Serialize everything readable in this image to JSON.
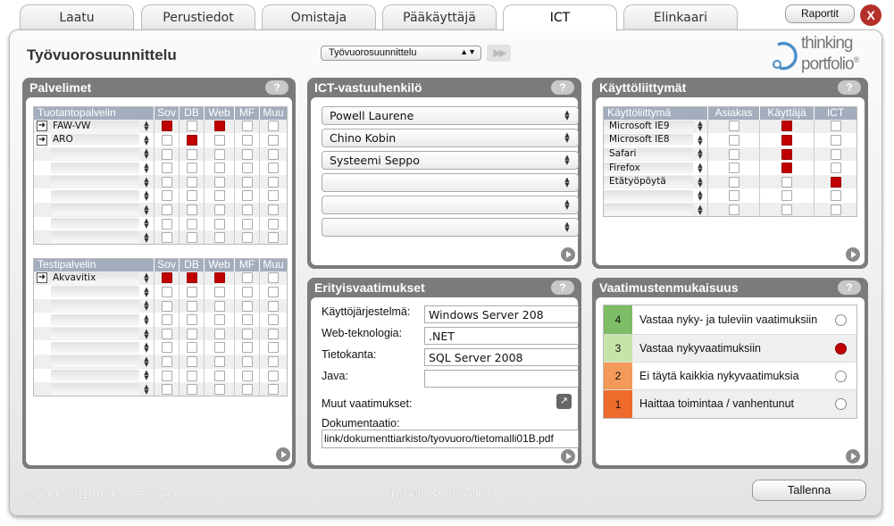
{
  "tabs": [
    {
      "label": "Laatu"
    },
    {
      "label": "Perustiedot"
    },
    {
      "label": "Omistaja"
    },
    {
      "label": "Pääkäyttäjä"
    },
    {
      "label": "ICT",
      "active": true
    },
    {
      "label": "Elinkaari"
    }
  ],
  "reports_label": "Raportit",
  "close_label": "X",
  "page_title": "Työvuorosuunnittelu",
  "system_select": {
    "value": "Työvuorosuunnittelu"
  },
  "logo": {
    "line1": "thinking",
    "line2": "portfolio",
    "mark": "®"
  },
  "servers": {
    "title": "Palvelimet",
    "help": "?",
    "columns": [
      "Sov",
      "DB",
      "Web",
      "MF",
      "Muu"
    ],
    "production": {
      "header": "Tuotantopalvelin",
      "rows": [
        {
          "name": "FAW-VW",
          "checks": [
            true,
            false,
            true,
            false,
            false
          ]
        },
        {
          "name": "ARO",
          "checks": [
            false,
            true,
            false,
            false,
            false
          ]
        },
        {
          "name": "",
          "checks": [
            false,
            false,
            false,
            false,
            false
          ]
        },
        {
          "name": "",
          "checks": [
            false,
            false,
            false,
            false,
            false
          ]
        },
        {
          "name": "",
          "checks": [
            false,
            false,
            false,
            false,
            false
          ]
        },
        {
          "name": "",
          "checks": [
            false,
            false,
            false,
            false,
            false
          ]
        },
        {
          "name": "",
          "checks": [
            false,
            false,
            false,
            false,
            false
          ]
        },
        {
          "name": "",
          "checks": [
            false,
            false,
            false,
            false,
            false
          ]
        },
        {
          "name": "",
          "checks": [
            false,
            false,
            false,
            false,
            false
          ]
        }
      ]
    },
    "test": {
      "header": "Testipalvelin",
      "rows": [
        {
          "name": "Akvavitix",
          "checks": [
            true,
            true,
            true,
            false,
            false
          ]
        },
        {
          "name": "",
          "checks": [
            false,
            false,
            false,
            false,
            false
          ]
        },
        {
          "name": "",
          "checks": [
            false,
            false,
            false,
            false,
            false
          ]
        },
        {
          "name": "",
          "checks": [
            false,
            false,
            false,
            false,
            false
          ]
        },
        {
          "name": "",
          "checks": [
            false,
            false,
            false,
            false,
            false
          ]
        },
        {
          "name": "",
          "checks": [
            false,
            false,
            false,
            false,
            false
          ]
        },
        {
          "name": "",
          "checks": [
            false,
            false,
            false,
            false,
            false
          ]
        },
        {
          "name": "",
          "checks": [
            false,
            false,
            false,
            false,
            false
          ]
        },
        {
          "name": "",
          "checks": [
            false,
            false,
            false,
            false,
            false
          ]
        }
      ]
    }
  },
  "ict_contacts": {
    "title": "ICT-vastuuhenkilö",
    "help": "?",
    "people": [
      "Powell Laurene",
      "Chino Kobin",
      "Systeemi Seppo",
      "",
      "",
      ""
    ]
  },
  "interfaces": {
    "title": "Käyttöliittymät",
    "help": "?",
    "header": "Käyttöliittymä",
    "columns": [
      "Asiakas",
      "Käyttäjä",
      "ICT"
    ],
    "rows": [
      {
        "name": "Microsoft IE9",
        "checks": [
          false,
          true,
          false
        ]
      },
      {
        "name": "Microsoft IE8",
        "checks": [
          false,
          true,
          false
        ]
      },
      {
        "name": "Safari",
        "checks": [
          false,
          true,
          false
        ]
      },
      {
        "name": "Firefox",
        "checks": [
          false,
          true,
          false
        ]
      },
      {
        "name": "Etätyöpöytä",
        "checks": [
          false,
          false,
          true
        ]
      },
      {
        "name": "",
        "checks": [
          false,
          false,
          false
        ]
      },
      {
        "name": "",
        "checks": [
          false,
          false,
          false
        ]
      }
    ]
  },
  "special": {
    "title": "Erityisvaatimukset",
    "help": "?",
    "fields": [
      {
        "label": "Käyttöjärjestelmä:",
        "value": "Windows Server 208"
      },
      {
        "label": "Web-teknologia:",
        "value": ".NET"
      },
      {
        "label": "Tietokanta:",
        "value": "SQL Server 2008"
      },
      {
        "label": "Java:",
        "value": ""
      }
    ],
    "other_label": "Muut vaatimukset:",
    "doc_label": "Dokumentaatio:",
    "doc_value": "link/dokumenttiarkisto/tyovuoro/tietomalli01B.pdf"
  },
  "compliance": {
    "title": "Vaatimustenmukaisuus",
    "help": "?",
    "levels": [
      {
        "num": "4",
        "text": "Vastaa nyky- ja tuleviin vaatimuksiin",
        "color": "#7dbd68",
        "selected": false
      },
      {
        "num": "3",
        "text": "Vastaa nykyvaatimuksiin",
        "color": "#c6e4a9",
        "selected": true
      },
      {
        "num": "2",
        "text": "Ei täytä kaikkia nykyvaatimuksia",
        "color": "#f39a58",
        "selected": false
      },
      {
        "num": "1",
        "text": "Haittaa toimintaa / vanhentunut",
        "color": "#ee6b2c",
        "selected": false
      }
    ]
  },
  "footer": {
    "copyright": "© 2006-2011 Thinking Business",
    "product": "Thinking Portfolio ICT",
    "save_label": "Tallenna"
  },
  "colors": {
    "accent": "#c00000",
    "panel_header": "#7b7b7b",
    "table_header": "#a3adbd"
  }
}
